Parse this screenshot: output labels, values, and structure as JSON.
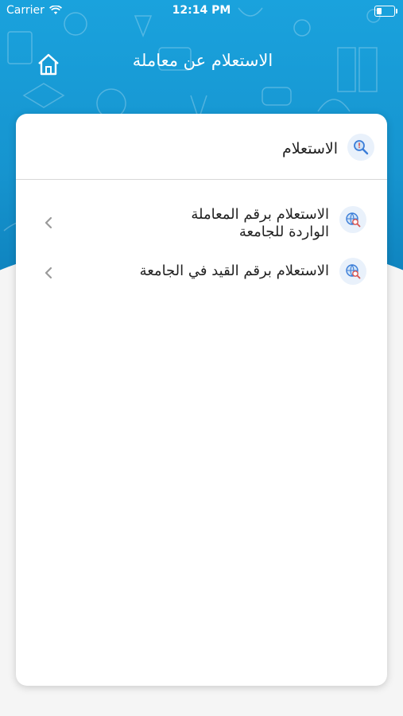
{
  "status_bar": {
    "carrier": "Carrier",
    "time": "12:14 PM"
  },
  "header": {
    "title": "الاستعلام عن معاملة"
  },
  "section": {
    "title": "الاستعلام"
  },
  "menu": {
    "items": [
      {
        "label_line1": "الاستعلام برقم المعاملة",
        "label_line2": "الواردة للجامعة"
      },
      {
        "label_line1": "الاستعلام برقم القيد في الجامعة"
      }
    ]
  },
  "colors": {
    "header_blue": "#1aa2dd",
    "icon_bg": "#e9f1fb",
    "icon_accent": "#3b7dd8",
    "icon_red": "#d9534f"
  }
}
